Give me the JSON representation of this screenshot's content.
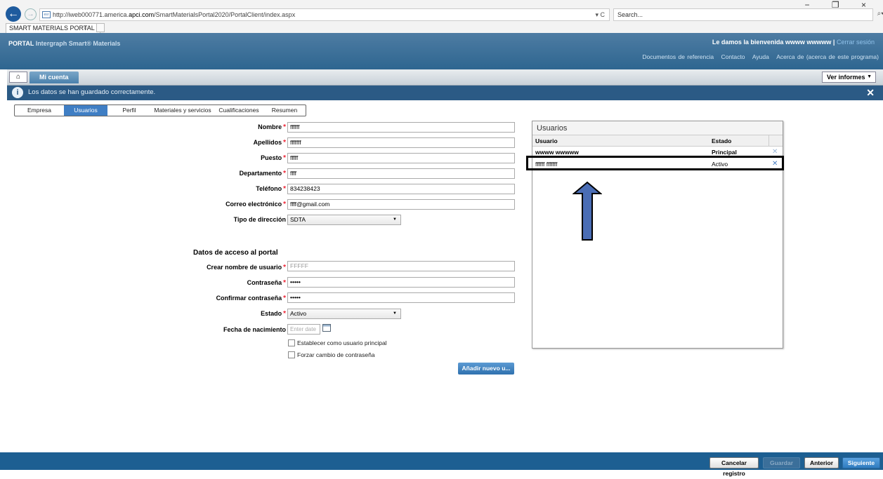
{
  "browser": {
    "url_prefix": "http://iweb000771.america.",
    "url_domain": "apci.com",
    "url_suffix": "/SmartMaterialsPortal2020/PortalClient/index.aspx",
    "url_controls": "▾ C",
    "search_placeholder": "Search...",
    "search_controls": "⌕▾ ⌂ ☆ ⚙ ☺",
    "tab_title": "SMART MATERIALS PORTAL",
    "tab_close": "×",
    "window_controls": "− ❐ ×",
    "back_icon": "←",
    "fwd_icon": "→",
    "favicon": "esr"
  },
  "header": {
    "brand_portal": "PORTAL",
    "brand_name": "Intergraph Smart® Materials",
    "welcome": "Le damos la bienvenida wwww wwwww |",
    "logout": "Cerrar sesión",
    "links": [
      "Documentos de referencia",
      "Contacto",
      "Ayuda",
      "Acerca de (acerca de este programa)"
    ]
  },
  "toolbar": {
    "home_icon": "⌂",
    "my_account": "Mi cuenta",
    "reports": "Ver informes",
    "reports_dd": "▼"
  },
  "info": {
    "icon": "i",
    "message": "Los datos se han guardado correctamente.",
    "close": "✕"
  },
  "steps": [
    "Empresa",
    "Usuarios",
    "Perfil",
    "Materiales y servicios",
    "Cualificaciones",
    "Resumen"
  ],
  "form": {
    "nombre_label": "Nombre",
    "nombre_value": "ffffff",
    "apellidos_label": "Apellidos",
    "apellidos_value": "fffffff",
    "puesto_label": "Puesto",
    "puesto_value": "fffff",
    "departamento_label": "Departamento",
    "departamento_value": "ffff",
    "telefono_label": "Teléfono",
    "telefono_value": "834238423",
    "correo_label": "Correo electrónico",
    "correo_value": "ffff@gmail.com",
    "tipo_label": "Tipo de dirección",
    "tipo_value": "SDTA",
    "section_title": "Datos de acceso al portal",
    "usuario_label": "Crear nombre de usuario",
    "usuario_value": "FFFFF",
    "contrasena_label": "Contraseña",
    "contrasena_value": "•••••",
    "confirmar_label": "Confirmar contraseña",
    "confirmar_value": "•••••",
    "estado_label": "Estado",
    "estado_value": "Activo",
    "fecha_label": "Fecha de nacimiento",
    "fecha_placeholder": "Enter date",
    "principal_label": "Establecer como usuario principal",
    "forzar_label": "Forzar cambio de contraseña",
    "add_button": "Añadir nuevo u...",
    "required_mark": "*",
    "dd": "▼"
  },
  "users_panel": {
    "title": "Usuarios",
    "col_user": "Usuario",
    "col_state": "Estado",
    "rows": [
      {
        "user": "wwww wwwww",
        "state": "Principal",
        "remove": "✕"
      },
      {
        "user": "ffffff fffffff",
        "state": "Activo",
        "remove": "✕"
      }
    ]
  },
  "bottom": {
    "cancel": "Cancelar registro",
    "save": "Guardar",
    "prev": "Anterior",
    "next": "Siguiente"
  },
  "colors": {
    "header": "#2e6690",
    "info_bar": "#2b5a85",
    "active_step": "#3f7ec4",
    "required": "#e22233",
    "arrow_fill": "#4a6db5"
  }
}
